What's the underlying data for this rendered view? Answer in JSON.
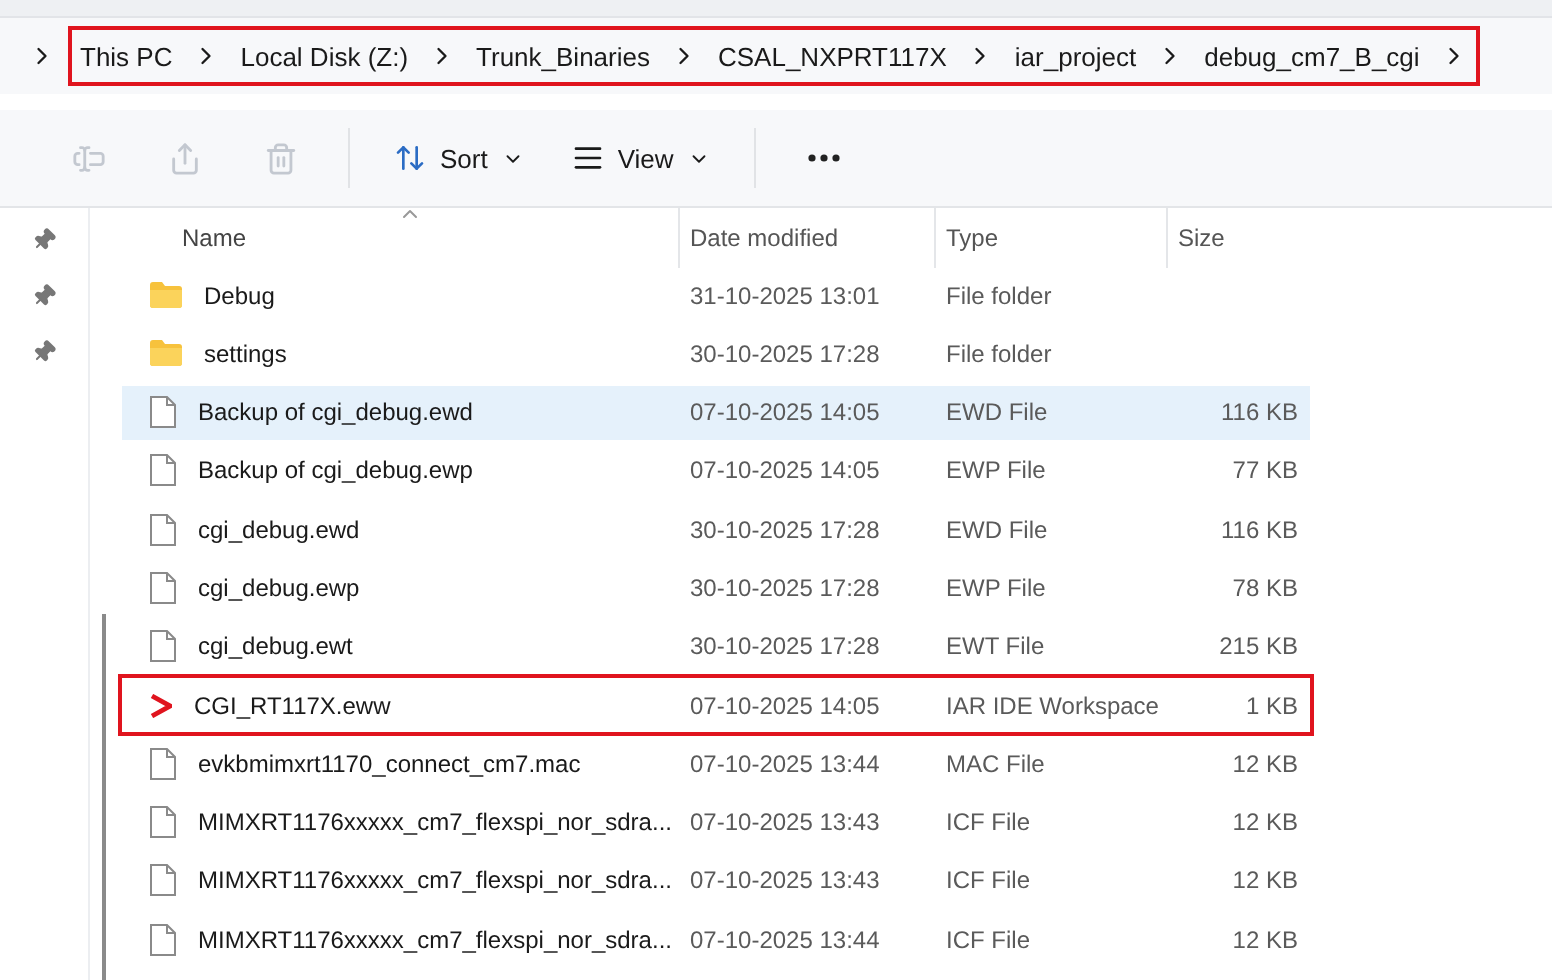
{
  "breadcrumb": {
    "outlined": true,
    "items": [
      "This PC",
      "Local Disk (Z:)",
      "Trunk_Binaries",
      "CSAL_NXPRT117X",
      "iar_project",
      "debug_cm7_B_cgi"
    ]
  },
  "toolbar": {
    "actions": [
      {
        "kind": "rename",
        "disabled": true
      },
      {
        "kind": "share",
        "disabled": true
      },
      {
        "kind": "delete",
        "disabled": true
      }
    ],
    "sort": {
      "label": "Sort"
    },
    "view": {
      "label": "View"
    }
  },
  "table": {
    "columns": [
      {
        "label": "Name",
        "sorted": true
      },
      {
        "label": "Date modified",
        "sorted": false
      },
      {
        "label": "Type",
        "sorted": false
      },
      {
        "label": "Size",
        "sorted": false
      }
    ],
    "rows": [
      {
        "kind": "folder",
        "name": "Debug",
        "date": "31-10-2025 13:01",
        "type": "File folder",
        "size": "",
        "selected": false,
        "outlined": false
      },
      {
        "kind": "folder",
        "name": "settings",
        "date": "30-10-2025 17:28",
        "type": "File folder",
        "size": "",
        "selected": false,
        "outlined": false
      },
      {
        "kind": "file",
        "name": "Backup of cgi_debug.ewd",
        "date": "07-10-2025 14:05",
        "type": "EWD File",
        "size": "116 KB",
        "selected": true,
        "outlined": false
      },
      {
        "kind": "file",
        "name": "Backup of cgi_debug.ewp",
        "date": "07-10-2025 14:05",
        "type": "EWP File",
        "size": "77 KB",
        "selected": false,
        "outlined": false
      },
      {
        "kind": "file",
        "name": "cgi_debug.ewd",
        "date": "30-10-2025 17:28",
        "type": "EWD File",
        "size": "116 KB",
        "selected": false,
        "outlined": false
      },
      {
        "kind": "file",
        "name": "cgi_debug.ewp",
        "date": "30-10-2025 17:28",
        "type": "EWP File",
        "size": "78 KB",
        "selected": false,
        "outlined": false
      },
      {
        "kind": "file",
        "name": "cgi_debug.ewt",
        "date": "30-10-2025 17:28",
        "type": "EWT File",
        "size": "215 KB",
        "selected": false,
        "outlined": false
      },
      {
        "kind": "workspace",
        "name": "CGI_RT117X.eww",
        "date": "07-10-2025 14:05",
        "type": "IAR IDE Workspace",
        "size": "1 KB",
        "selected": false,
        "outlined": true
      },
      {
        "kind": "file",
        "name": "evkbmimxrt1170_connect_cm7.mac",
        "date": "07-10-2025 13:44",
        "type": "MAC File",
        "size": "12 KB",
        "selected": false,
        "outlined": false
      },
      {
        "kind": "file",
        "name": "MIMXRT1176xxxxx_cm7_flexspi_nor_sdra...",
        "date": "07-10-2025 13:43",
        "type": "ICF File",
        "size": "12 KB",
        "selected": false,
        "outlined": false
      },
      {
        "kind": "file",
        "name": "MIMXRT1176xxxxx_cm7_flexspi_nor_sdra...",
        "date": "07-10-2025 13:43",
        "type": "ICF File",
        "size": "12 KB",
        "selected": false,
        "outlined": false
      },
      {
        "kind": "file",
        "name": "MIMXRT1176xxxxx_cm7_flexspi_nor_sdra...",
        "date": "07-10-2025 13:44",
        "type": "ICF File",
        "size": "12 KB",
        "selected": false,
        "outlined": false
      }
    ]
  }
}
